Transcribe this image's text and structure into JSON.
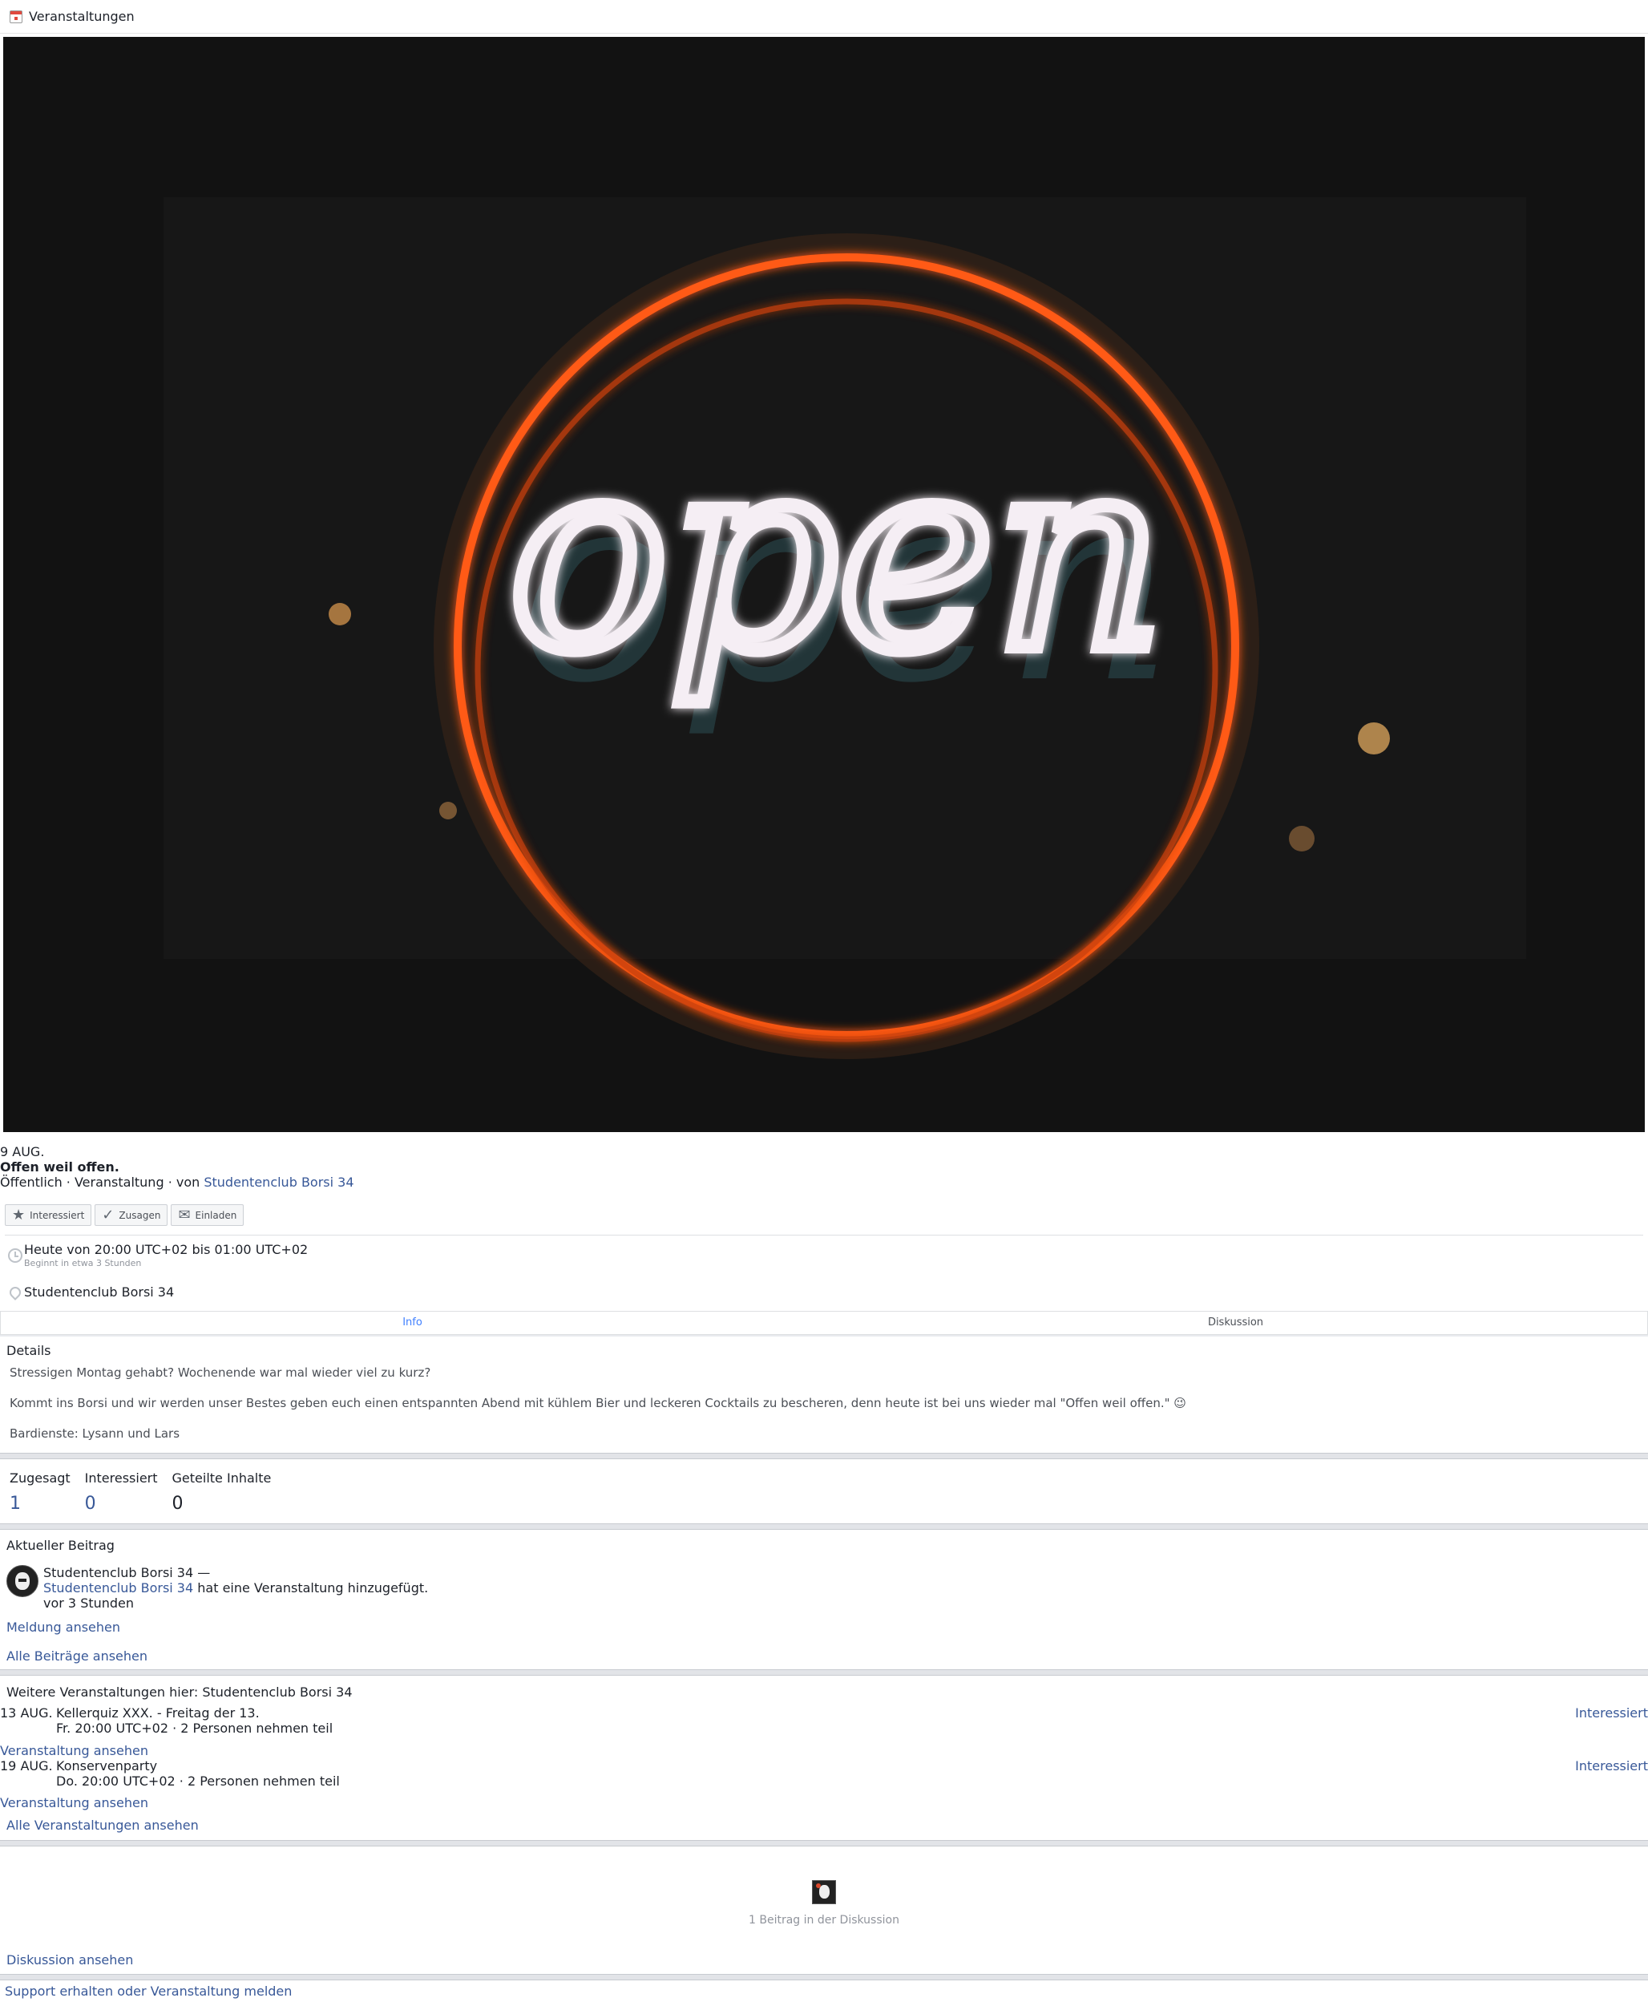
{
  "topbar": {
    "title": "Veranstaltungen",
    "icon": "calendar-icon"
  },
  "hero": {
    "sign_text": "open",
    "ring_color": "#ff5a14",
    "text_color": "#f5eef4"
  },
  "event": {
    "date": "9 AUG.",
    "title": "Offen weil offen.",
    "meta_prefix": "Öffentlich · Veranstaltung · von ",
    "host": "Studentenclub Borsi 34"
  },
  "actions": {
    "interested": "Interessiert",
    "going": "Zusagen",
    "invite": "Einladen"
  },
  "when": {
    "main": "Heute von 20:00 UTC+02 bis 01:00 UTC+02",
    "sub": "Beginnt in etwa 3 Stunden"
  },
  "location": "Studentenclub Borsi 34",
  "tabs": {
    "info": "Info",
    "discussion": "Diskussion"
  },
  "details": {
    "heading": "Details",
    "p1": "Stressigen Montag gehabt? Wochenende war mal wieder viel zu kurz?",
    "p2": "Kommt ins Borsi und wir werden unser Bestes geben euch einen entspannten Abend mit kühlem Bier und leckeren Cocktails zu bescheren, denn heute ist bei uns wieder mal \"Offen weil offen.\" 😉",
    "p3": "Bardienste: Lysann und Lars"
  },
  "stats": [
    {
      "label": "Zugesagt",
      "value": "1"
    },
    {
      "label": "Interessiert",
      "value": "0"
    },
    {
      "label": "Geteilte Inhalte",
      "value": "0"
    }
  ],
  "recent": {
    "heading": "Aktueller Beitrag",
    "author_line": "Studentenclub Borsi 34 —",
    "author_link": "Studentenclub Borsi 34",
    "action_text": " hat eine Veranstaltung hinzugefügt.",
    "time": "vor 3 Stunden",
    "view_post": "Meldung ansehen",
    "all_posts": "Alle Beiträge ansehen"
  },
  "more_events": {
    "heading": "Weitere Veranstaltungen hier: Studentenclub Borsi 34",
    "items": [
      {
        "date": "13 AUG.",
        "title": "Kellerquiz XXX. - Freitag der 13.",
        "sub": "Fr. 20:00 UTC+02 · 2 Personen nehmen teil",
        "interested": "Interessiert",
        "view": "Veranstaltung ansehen"
      },
      {
        "date": "19 AUG.",
        "title": "Konservenparty",
        "sub": "Do. 20:00 UTC+02 · 2 Personen nehmen teil",
        "interested": "Interessiert",
        "view": "Veranstaltung ansehen"
      }
    ],
    "all": "Alle Veranstaltungen ansehen"
  },
  "discussion": {
    "count_text": "1 Beitrag in der Diskussion",
    "view": "Diskussion ansehen"
  },
  "footer": {
    "support": "Support erhalten oder Veranstaltung melden"
  },
  "colors": {
    "link": "#385898",
    "active_tab": "#4080ff",
    "muted": "#90949c"
  }
}
